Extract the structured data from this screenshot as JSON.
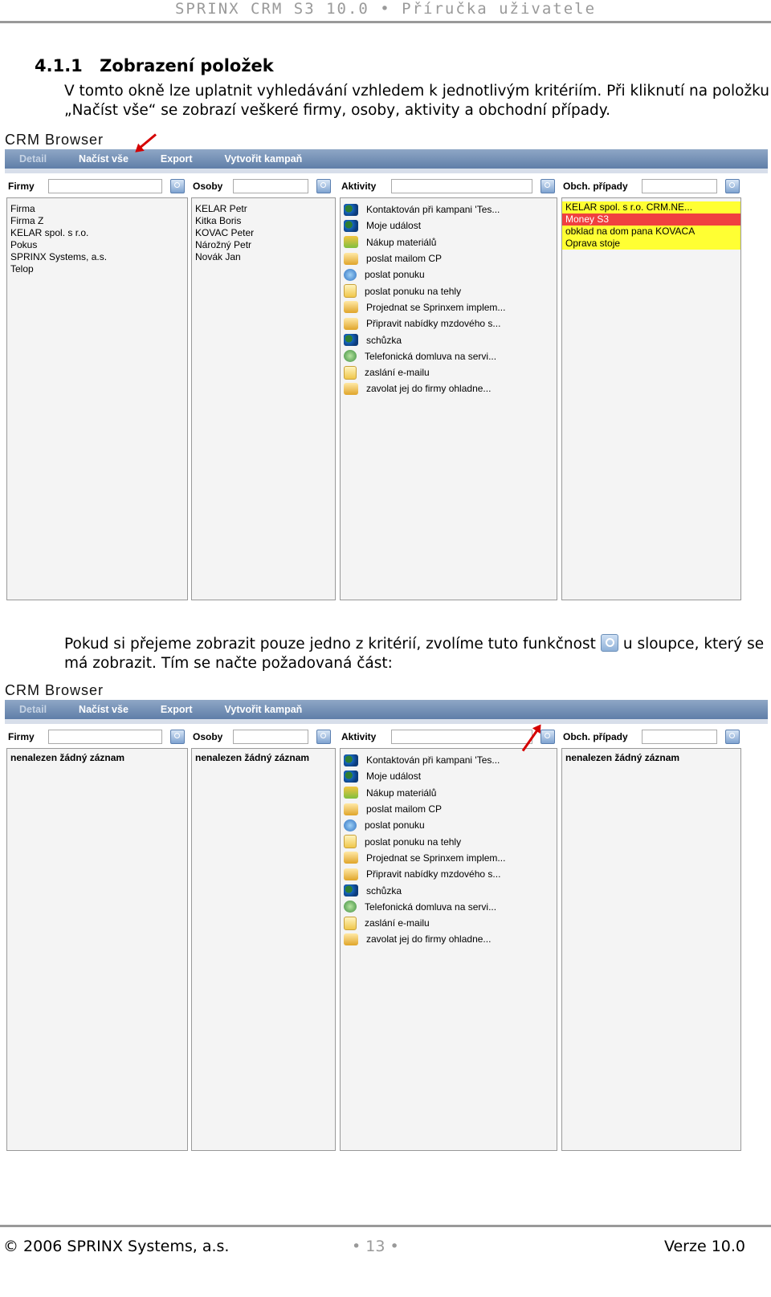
{
  "header": {
    "text": "SPRINX CRM S3 10.0  •  Příručka uživatele"
  },
  "section": {
    "number": "4.1.1",
    "title": "Zobrazení položek"
  },
  "para1": "V tomto okně lze uplatnit vyhledávání vzhledem k jednotlivým kritériím. Při kliknutí na položku „Načíst vše“ se zobrazí veškeré firmy, osoby, aktivity a obchodní případy.",
  "para2_a": "Pokud si přejeme zobrazit pouze jedno z kritérií, zvolíme tuto funkčnost",
  "para2_b": "u sloupce, který se má zobrazit. Tím se načte požadovaná část:",
  "browser": {
    "title": "CRM Browser",
    "toolbar": [
      "Detail",
      "Načíst vše",
      "Export",
      "Vytvořit kampaň"
    ],
    "filters": [
      "Firmy",
      "Osoby",
      "Aktivity",
      "Obch. případy"
    ]
  },
  "screen1": {
    "firmy": [
      "Firma",
      "Firma Z",
      "KELAR spol. s r.o.",
      "Pokus",
      "SPRINX Systems, a.s.",
      "Telop"
    ],
    "osoby": [
      "KELAR Petr",
      "Kitka Boris",
      "KOVAC Peter",
      "Nárožný Petr",
      "Novák Jan"
    ],
    "pripady": [
      {
        "label": "KELAR spol. s r.o. CRM.NE...",
        "color": "#ffff33"
      },
      {
        "label": "Money S3",
        "color": "#f04040"
      },
      {
        "label": "obklad na dom pana KOVACA",
        "color": "#ffff33"
      },
      {
        "label": "Oprava stoje",
        "color": "#ffff33"
      }
    ]
  },
  "screen2": {
    "empty": "nenalezen žádný záznam"
  },
  "aktivity": [
    {
      "label": "Kontaktován při kampani 'Tes...",
      "icon": "people-icon"
    },
    {
      "label": "Moje událost",
      "icon": "people-icon"
    },
    {
      "label": "Nákup materiálů",
      "icon": "basket-icon"
    },
    {
      "label": "poslat mailom CP",
      "icon": "mail-icon"
    },
    {
      "label": "poslat ponuku",
      "icon": "globe-icon"
    },
    {
      "label": "poslat ponuku na tehly",
      "icon": "note-icon"
    },
    {
      "label": "Projednat se Sprinxem implem...",
      "icon": "mail-icon"
    },
    {
      "label": "Připravit nabídky mzdového s...",
      "icon": "mail-icon"
    },
    {
      "label": "schůzka",
      "icon": "people-icon"
    },
    {
      "label": "Telefonická domluva na servi...",
      "icon": "phone-icon"
    },
    {
      "label": "zaslání e-mailu",
      "icon": "note-icon"
    },
    {
      "label": "zavolat jej do firmy ohladne...",
      "icon": "mail-icon"
    }
  ],
  "footer": {
    "left": "© 2006 SPRINX Systems, a.s.",
    "page": "• 13 •",
    "right": "Verze 10.0"
  }
}
